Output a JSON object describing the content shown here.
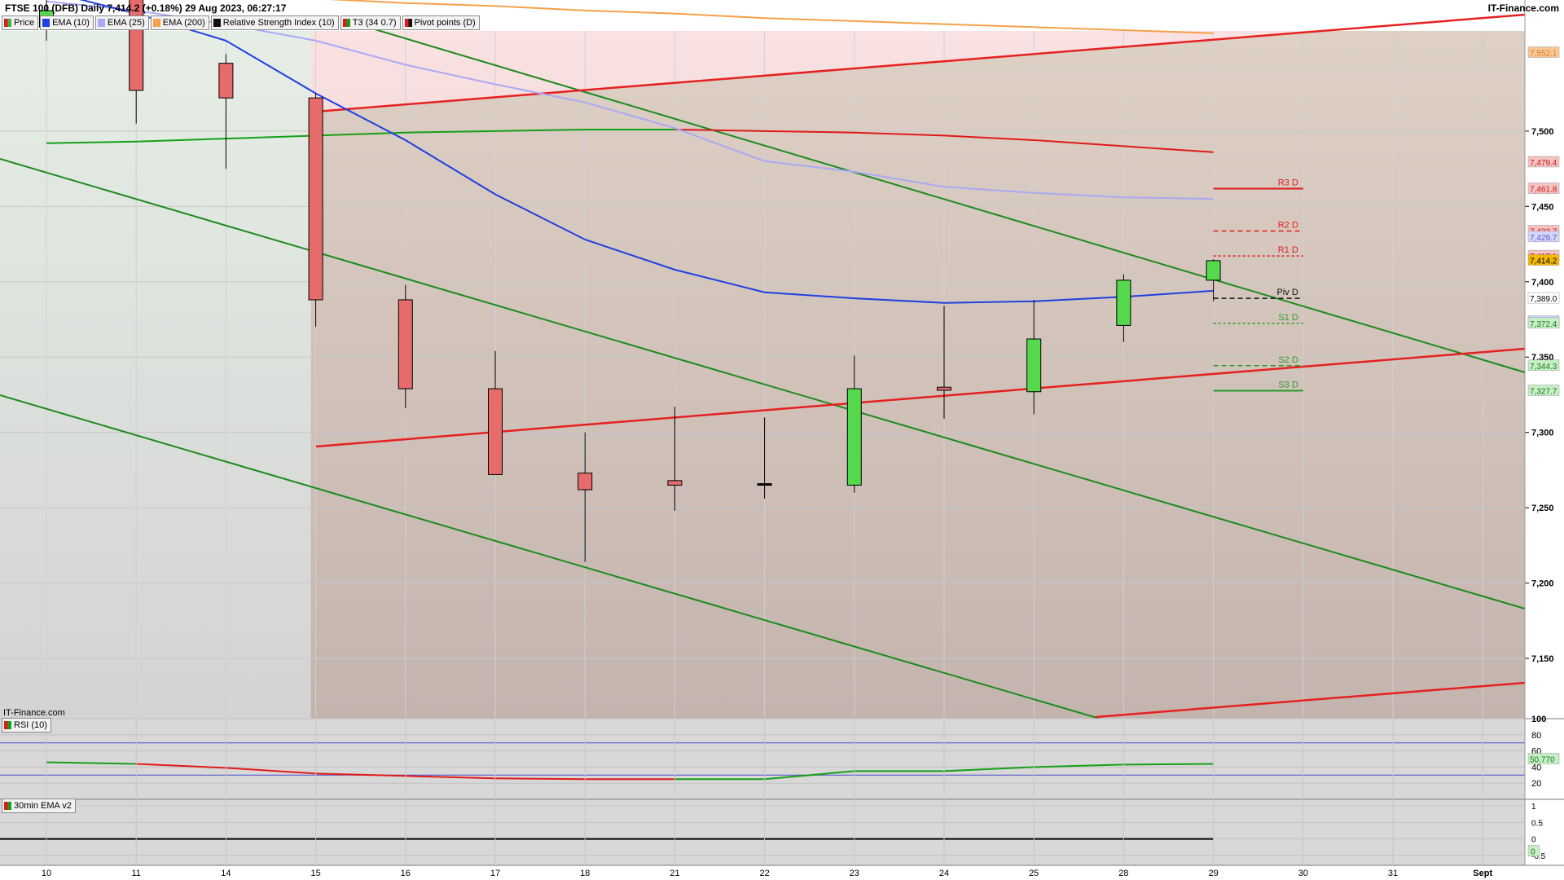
{
  "header": {
    "title": "FTSE 100 (DFB) Daily 7,414.2 (+0.18%) 29 Aug 2023, 06:27:17",
    "brand": "IT-Finance.com"
  },
  "legend": [
    {
      "label": "Price",
      "swatch": "candle",
      "color": "#3fb24a"
    },
    {
      "label": "EMA (10)",
      "swatch": "solid",
      "color": "#1f3fe0"
    },
    {
      "label": "EMA (25)",
      "swatch": "solid",
      "color": "#a9a9f5"
    },
    {
      "label": "EMA (200)",
      "swatch": "solid",
      "color": "#f5a14a"
    },
    {
      "label": "Relative Strength Index (10)",
      "swatch": "solid",
      "color": "#111111"
    },
    {
      "label": "T3 (34 0.7)",
      "swatch": "redgreen",
      "color": "#e02020"
    },
    {
      "label": "Pivot points (D)",
      "swatch": "redgreen",
      "color": "#111111"
    }
  ],
  "watermark": "IT-Finance.com",
  "rsi_label": "RSI (10)",
  "ema30_label": "30min EMA v2",
  "colors": {
    "up": "#54d84c",
    "down": "#e66b6b",
    "ema10": "#1f3fe0",
    "ema25": "#a9a9f5",
    "ema200": "#f5a14a",
    "t3_up": "#16a016",
    "t3_down": "#e01a1a",
    "channel_green": "#1e8a1e",
    "channel_red": "#e62020"
  },
  "chart_data": {
    "type": "candlestick",
    "x_labels": [
      "10",
      "11",
      "14",
      "15",
      "16",
      "17",
      "18",
      "21",
      "22",
      "23",
      "24",
      "25",
      "28",
      "29",
      "30",
      "31",
      "Sept"
    ],
    "y_ticks": [
      "7,150",
      "7,200",
      "7,250",
      "7,300",
      "7,350",
      "7,400",
      "7,450",
      "7,500"
    ],
    "y_tick_values": [
      7150,
      7200,
      7250,
      7300,
      7350,
      7400,
      7450,
      7500
    ],
    "ylim": [
      7110,
      7587
    ],
    "candles": [
      {
        "date": "10",
        "open": 7569,
        "close": 7580,
        "high": 7595,
        "low": 7560,
        "dir": "up"
      },
      {
        "date": "11",
        "open": 7591,
        "close": 7527,
        "high": 7597,
        "low": 7505,
        "dir": "down"
      },
      {
        "date": "14",
        "open": 7545,
        "close": 7522,
        "high": 7551,
        "low": 7475,
        "dir": "down"
      },
      {
        "date": "15",
        "open": 7522,
        "close": 7388,
        "high": 7525,
        "low": 7370,
        "dir": "down"
      },
      {
        "date": "16",
        "open": 7388,
        "close": 7329,
        "high": 7398,
        "low": 7316,
        "dir": "down"
      },
      {
        "date": "17",
        "open": 7329,
        "close": 7272,
        "high": 7354,
        "low": 7272,
        "dir": "down"
      },
      {
        "date": "18",
        "open": 7273,
        "close": 7262,
        "high": 7300,
        "low": 7214,
        "dir": "down"
      },
      {
        "date": "21",
        "open": 7268,
        "close": 7265,
        "high": 7317,
        "low": 7248,
        "dir": "down"
      },
      {
        "date": "22",
        "open": 7266,
        "close": 7265,
        "high": 7310,
        "low": 7256,
        "dir": "down"
      },
      {
        "date": "23",
        "open": 7265,
        "close": 7329,
        "high": 7351,
        "low": 7260,
        "dir": "up"
      },
      {
        "date": "24",
        "open": 7330,
        "close": 7328,
        "high": 7384,
        "low": 7309,
        "dir": "down"
      },
      {
        "date": "25",
        "open": 7327,
        "close": 7362,
        "high": 7388,
        "low": 7312,
        "dir": "up"
      },
      {
        "date": "28",
        "open": 7371,
        "close": 7401,
        "high": 7405,
        "low": 7360,
        "dir": "up"
      },
      {
        "date": "29",
        "open": 7401,
        "close": 7414,
        "high": 7415,
        "low": 7387,
        "dir": "up"
      }
    ],
    "series": [
      {
        "name": "EMA (10)",
        "values": [
          7593,
          7578,
          7560,
          7525,
          7494,
          7458,
          7428,
          7408,
          7393,
          7389,
          7386,
          7387,
          7390,
          7394
        ]
      },
      {
        "name": "EMA (25)",
        "values": [
          7586,
          7580,
          7571,
          7560,
          7544,
          7531,
          7519,
          7502,
          7480,
          7473,
          7463,
          7459,
          7456,
          7455
        ]
      },
      {
        "name": "EMA (200)",
        "values": [
          7600,
          7594,
          7590,
          7588,
          7585,
          7583,
          7580,
          7578,
          7575,
          7573,
          7571,
          7569,
          7567,
          7565
        ]
      },
      {
        "name": "T3 (34 0.7)",
        "values": [
          7492,
          7493,
          7495,
          7497,
          7499,
          7500,
          7501,
          7501,
          7500,
          7499,
          7497,
          7494,
          7490,
          7486
        ]
      }
    ],
    "pivots": [
      {
        "label": "R3 D",
        "value": 7461.8,
        "color": "#e01a1a",
        "style": "solid"
      },
      {
        "label": "R2 D",
        "value": 7433.7,
        "color": "#e01a1a",
        "style": "dashed"
      },
      {
        "label": "R1 D",
        "value": 7417.1,
        "color": "#e01a1a",
        "style": "dotted"
      },
      {
        "label": "Piv D",
        "value": 7389.0,
        "color": "#111111",
        "style": "dashed"
      },
      {
        "label": "S1 D",
        "value": 7372.4,
        "color": "#2a9a2a",
        "style": "dotted"
      },
      {
        "label": "S2 D",
        "value": 7344.3,
        "color": "#2a9a2a",
        "style": "dashed"
      },
      {
        "label": "S3 D",
        "value": 7327.7,
        "color": "#2a9a2a",
        "style": "solid"
      }
    ],
    "price_tags": [
      {
        "text": "7,552.1",
        "value": 7552.1,
        "bg": "#f9c89a",
        "fg": "#e07a1a"
      },
      {
        "text": "7,479.4",
        "value": 7479.4,
        "bg": "#f7c2c2",
        "fg": "#c41a1a"
      },
      {
        "text": "7,461.8",
        "value": 7461.8,
        "bg": "#f7c2c2",
        "fg": "#c41a1a"
      },
      {
        "text": "7,433.7",
        "value": 7433.7,
        "bg": "#f7c2c2",
        "fg": "#c41a1a"
      },
      {
        "text": "7,429.7",
        "value": 7429.7,
        "bg": "#d6d6fb",
        "fg": "#5a5ad6"
      },
      {
        "text": "7,417.1",
        "value": 7417.1,
        "bg": "#f7c2c2",
        "fg": "#c41a1a"
      },
      {
        "text": "7,414.2",
        "value": 7414.2,
        "bg": "#f5b800",
        "fg": "#000000"
      },
      {
        "text": "7,389.0",
        "value": 7389.0,
        "bg": "#ffffff",
        "fg": "#000000"
      },
      {
        "text": "7,373.6",
        "value": 7373.6,
        "bg": "#c9d3fb",
        "fg": "#1f3fe0"
      },
      {
        "text": "7,372.4",
        "value": 7372.4,
        "bg": "#c6efc6",
        "fg": "#1a7a1a"
      },
      {
        "text": "7,344.3",
        "value": 7344.3,
        "bg": "#c6efc6",
        "fg": "#1a7a1a"
      },
      {
        "text": "7,327.7",
        "value": 7327.7,
        "bg": "#c6efc6",
        "fg": "#1a7a1a"
      }
    ],
    "rsi": {
      "ticks": [
        "100",
        "80",
        "60",
        "40",
        "20"
      ],
      "tick_values": [
        100,
        80,
        60,
        40,
        20
      ],
      "ylim": [
        0,
        100
      ],
      "levels": [
        70,
        30
      ],
      "values": [
        46,
        44,
        39,
        32,
        29,
        26,
        25,
        25,
        25,
        35,
        35,
        40,
        43,
        44
      ],
      "value_tag": "50.770"
    },
    "ema30": {
      "ticks": [
        "1",
        "0.5",
        "0",
        "-0.5"
      ],
      "tick_values": [
        1,
        0.5,
        0,
        -0.5
      ],
      "ylim": [
        -0.8,
        1.2
      ],
      "value": 0,
      "value_tag": "0"
    }
  }
}
